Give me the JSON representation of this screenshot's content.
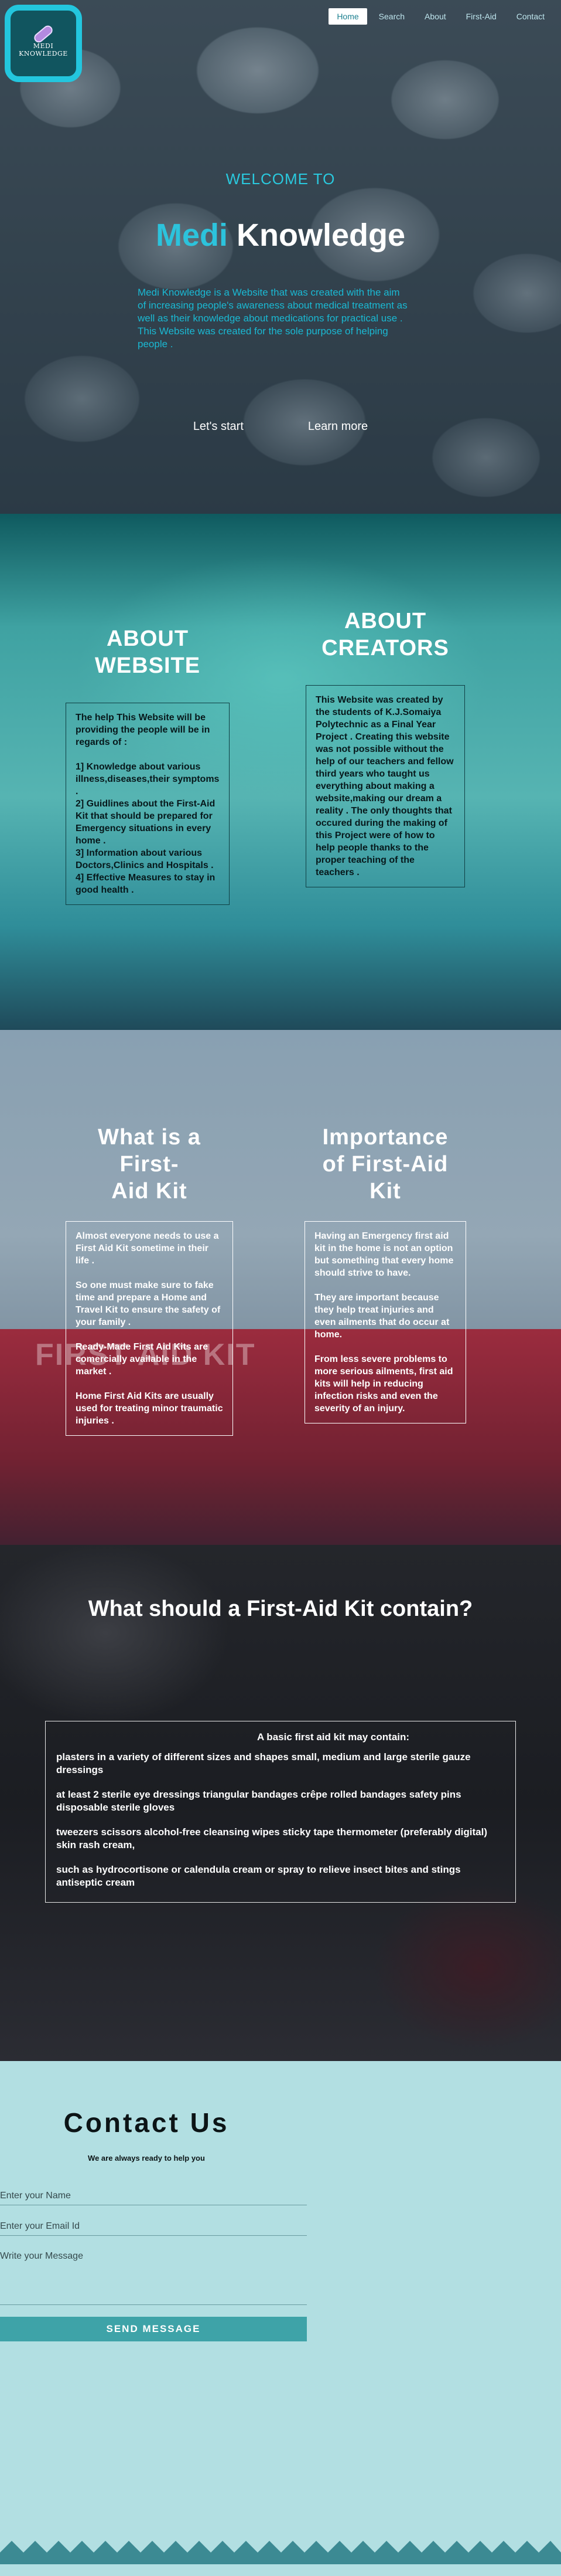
{
  "logo": {
    "text_line1": "MEDI",
    "text_line2": "KNOWLEDGE"
  },
  "nav": [
    {
      "label": "Home"
    },
    {
      "label": "Search"
    },
    {
      "label": "About"
    },
    {
      "label": "First-Aid"
    },
    {
      "label": "Contact"
    }
  ],
  "hero": {
    "welcome": "WELCOME TO",
    "title_accent": "Medi",
    "title_rest": " Knowledge",
    "intro": [
      "Medi Knowledge is a Website that was created with the aim",
      "of increasing people's awareness about medical treatment as well as their knowledge about medications for practical use .",
      "This Website was created for the sole purpose of helping people ."
    ],
    "lets_start": "Let's start",
    "learn_more": "Learn more"
  },
  "about": {
    "website_title_line1": "ABOUT",
    "website_title_line2": "WEBSITE",
    "website_paragraphs": [
      "The help This Website will be providing the people will be in regards of :",
      "",
      "1] Knowledge about various illness,diseases,their symptoms .",
      "2] Guidlines about the First-Aid Kit that should be prepared for Emergency situations in every home .",
      "3] Information about various Doctors,Clinics and Hospitals .",
      "4] Effective Measures to stay in good health ."
    ],
    "creators_title_line1": "ABOUT",
    "creators_title_line2": "CREATORS",
    "creators_text": "This Website was created by the students of K.J.Somaiya Polytechnic as a Final Year Project . Creating this website was not possible without the help of our teachers and fellow third years who taught us everything about making a website,making our dream a reality . The only thoughts that occured during the making of this Project were of how to help people thanks to the proper teaching of the teachers ."
  },
  "firstaid": {
    "bg_word": "FIRST AID KIT",
    "what_title_line1": "What is a First-",
    "what_title_line2": "Aid Kit",
    "what_paragraphs": [
      "Almost everyone needs to use a First Aid Kit sometime in their life .",
      "So one must make sure to fake time and prepare a Home and Travel Kit to ensure the safety of your family .",
      "Ready-Made First Aid Kits are comercially available in the market .",
      "Home First Aid Kits are usually used for treating minor traumatic injuries ."
    ],
    "importance_title_line1": "Importance",
    "importance_title_line2": "of First-Aid Kit",
    "importance_paragraphs": [
      "Having an Emergency first aid kit in the home is not an option but something that every home should strive to have.",
      "They are important because they help treat injuries and even ailments that do occur at home.",
      "From less severe problems to more serious ailments, first aid kits will help in reducing infection risks and even the severity of an injury."
    ]
  },
  "kit": {
    "title": "What should a First-Aid Kit contain?",
    "heading": "A basic first aid kit may contain:",
    "items": [
      "plasters in a variety of different sizes and shapes small, medium and large sterile gauze dressings",
      "at least 2 sterile eye dressings triangular bandages crêpe rolled bandages safety pins disposable sterile gloves",
      "tweezers scissors alcohol-free cleansing wipes sticky tape thermometer (preferably digital) skin rash cream,",
      "such as hydrocortisone or calendula cream or spray to relieve insect bites and stings antiseptic cream"
    ]
  },
  "contact": {
    "title": "Contact Us",
    "subtitle": "We are always ready to help you",
    "name_placeholder": "Enter your Name",
    "email_placeholder": "Enter your Email Id",
    "message_placeholder": "Write your Message",
    "send_label": "SEND MESSAGE"
  },
  "colors": {
    "accent": "#2cc3dc",
    "send_button": "#3ea3a8",
    "contact_bg": "#b2dfe2"
  }
}
